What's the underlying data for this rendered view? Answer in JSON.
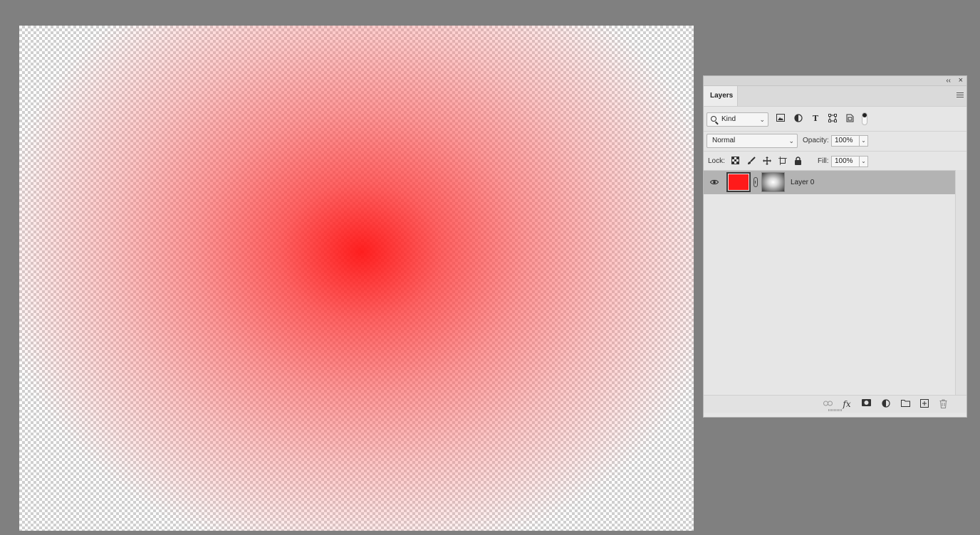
{
  "canvas": {
    "layer_color": "#ff1a1a",
    "checker_color": "#cfcfcf"
  },
  "panel": {
    "tab_label": "Layers",
    "collapse_glyph": "‹‹",
    "close_glyph": "×",
    "filter": {
      "kind_value": "Kind",
      "icons": [
        "image-filter-icon",
        "adjustment-filter-icon",
        "type-filter-icon",
        "shape-filter-icon",
        "smart-object-filter-icon"
      ]
    },
    "blend": {
      "mode": "Normal",
      "opacity_label": "Opacity:",
      "opacity_value": "100%"
    },
    "lock": {
      "label": "Lock:",
      "fill_label": "Fill:",
      "fill_value": "100%"
    },
    "layers": [
      {
        "name": "Layer 0",
        "visible": true,
        "color": "#ff1a1a"
      }
    ]
  }
}
